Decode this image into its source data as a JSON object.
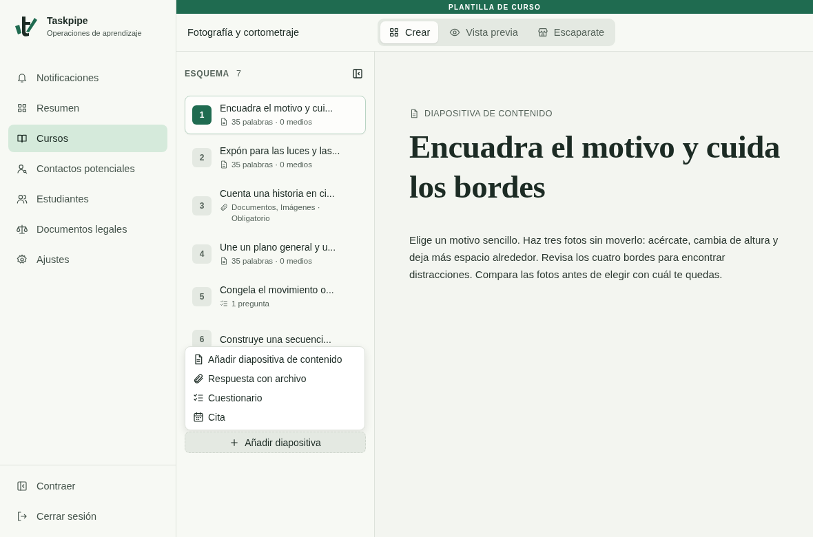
{
  "brand": {
    "name": "Taskpipe",
    "subtitle": "Operaciones de aprendizaje"
  },
  "nav": [
    {
      "label": "Notificaciones",
      "selected": false
    },
    {
      "label": "Resumen",
      "selected": false
    },
    {
      "label": "Cursos",
      "selected": true
    },
    {
      "label": "Contactos potenciales",
      "selected": false
    },
    {
      "label": "Estudiantes",
      "selected": false
    },
    {
      "label": "Documentos legales",
      "selected": false
    },
    {
      "label": "Ajustes",
      "selected": false
    }
  ],
  "nav_footer": [
    {
      "label": "Contraer"
    },
    {
      "label": "Cerrar sesión"
    }
  ],
  "banner": "PLANTILLA DE CURSO",
  "course_title": "Fotografía y cortometraje",
  "tabs": [
    {
      "label": "Crear",
      "selected": true
    },
    {
      "label": "Vista previa",
      "selected": false
    },
    {
      "label": "Escaparate",
      "selected": false
    }
  ],
  "outline": {
    "title": "ESQUEMA",
    "count": "7",
    "items": [
      {
        "number": "1",
        "title": "Encuadra el motivo y cui...",
        "kind": "content",
        "meta": "35 palabras · 0 medios",
        "selected": true
      },
      {
        "number": "2",
        "title": "Expón para las luces y las...",
        "kind": "content",
        "meta": "35 palabras · 0 medios",
        "selected": false
      },
      {
        "number": "3",
        "title": "Cuenta una historia en ci...",
        "kind": "file",
        "meta": "Documentos, Imágenes · Obligatorio",
        "selected": false
      },
      {
        "number": "4",
        "title": "Une un plano general y u...",
        "kind": "content",
        "meta": "35 palabras · 0 medios",
        "selected": false
      },
      {
        "number": "5",
        "title": "Congela el movimiento o...",
        "kind": "quiz",
        "meta": "1 pregunta",
        "selected": false
      },
      {
        "number": "6",
        "title": "Construye una secuenci...",
        "selected": false
      }
    ],
    "menu": [
      {
        "label": "Añadir diapositiva de contenido",
        "kind": "content"
      },
      {
        "label": "Respuesta con archivo",
        "kind": "file"
      },
      {
        "label": "Cuestionario",
        "kind": "quiz"
      },
      {
        "label": "Cita",
        "kind": "appointment"
      }
    ],
    "add_button": "Añadir diapositiva"
  },
  "slide": {
    "type_label": "DIAPOSITIVA DE CONTENIDO",
    "kind": "content",
    "title": "Encuadra el motivo y cuida los bordes",
    "body": "Elige un motivo sencillo. Haz tres fotos sin moverlo: acércate, cambia de altura y deja más espacio alrededor. Revisa los cuatro bordes para encontrar distracciones. Compara las fotos antes de elegir con cuál te quedas."
  }
}
